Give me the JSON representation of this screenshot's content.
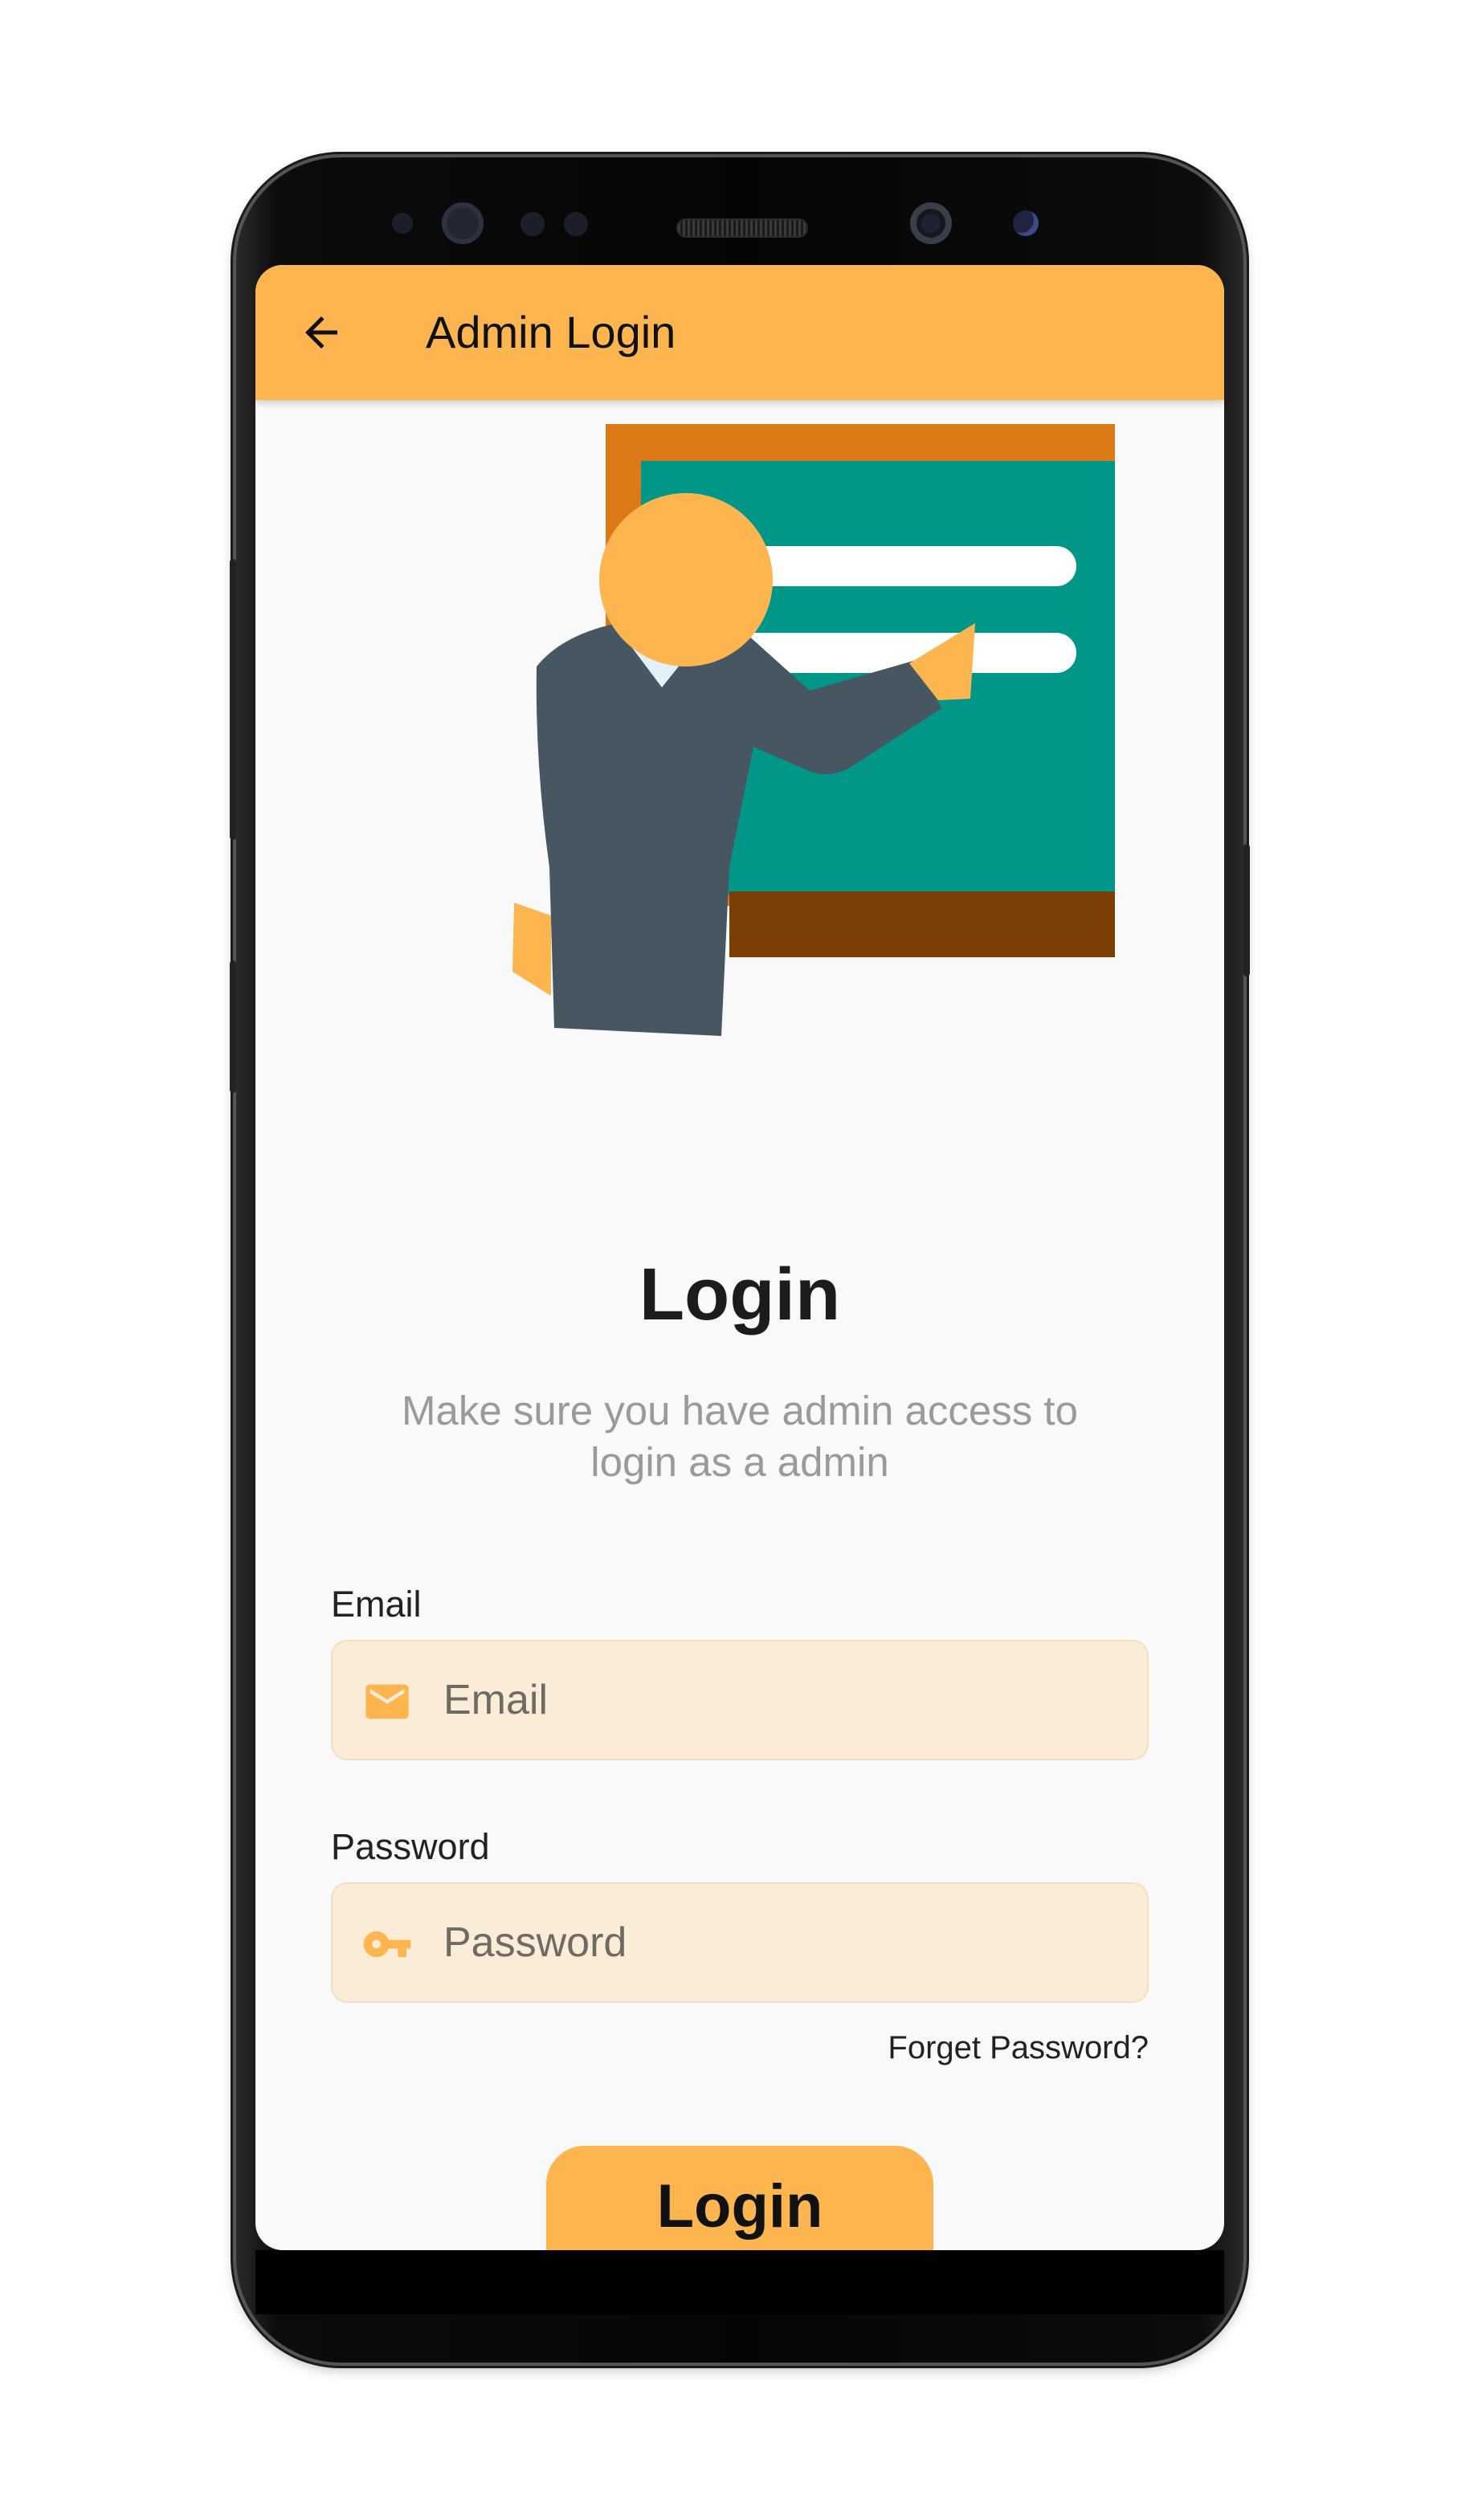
{
  "app_bar": {
    "title": "Admin Login",
    "back_icon": "arrow-left-icon"
  },
  "illustration": {
    "name": "teacher-at-chalkboard-illustration"
  },
  "main": {
    "title": "Login",
    "subtitle": "Make sure you have admin access to login as a admin"
  },
  "form": {
    "email": {
      "label": "Email",
      "placeholder": "Email",
      "value": "",
      "icon": "mail-icon"
    },
    "password": {
      "label": "Password",
      "placeholder": "Password",
      "value": "",
      "icon": "key-icon"
    },
    "forgot_label": "Forget Password?",
    "login_label": "Login"
  },
  "colors": {
    "accent": "#fdb64f",
    "input_bg": "#fbecd8",
    "board": "#009688",
    "board_frame": "#dd7a18",
    "background": "#f9f9f9"
  }
}
